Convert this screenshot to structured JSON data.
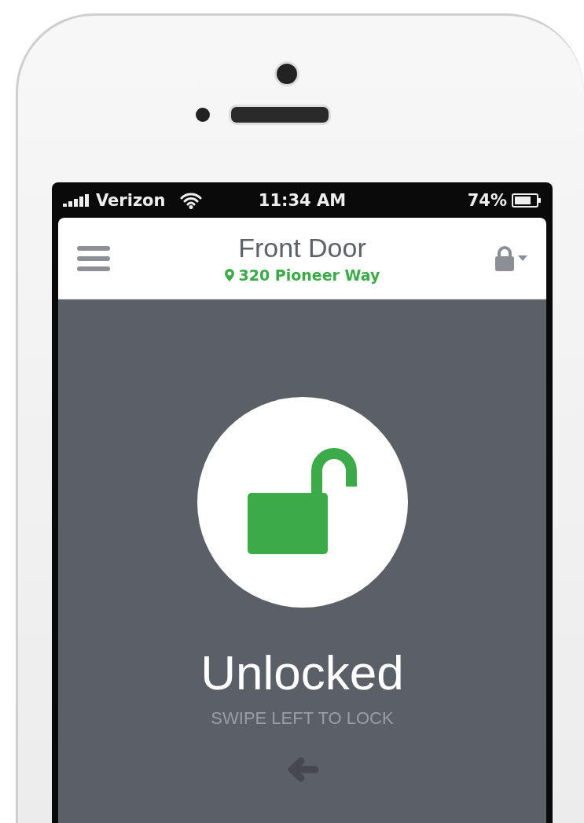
{
  "status_bar": {
    "carrier": "Verizon",
    "time": "11:34 AM",
    "battery": "74%"
  },
  "header": {
    "title": "Front Door",
    "address": "320 Pioneer Way"
  },
  "lock": {
    "locked": false,
    "status": "Unlocked",
    "hint": "SWIPE LEFT TO LOCK"
  }
}
